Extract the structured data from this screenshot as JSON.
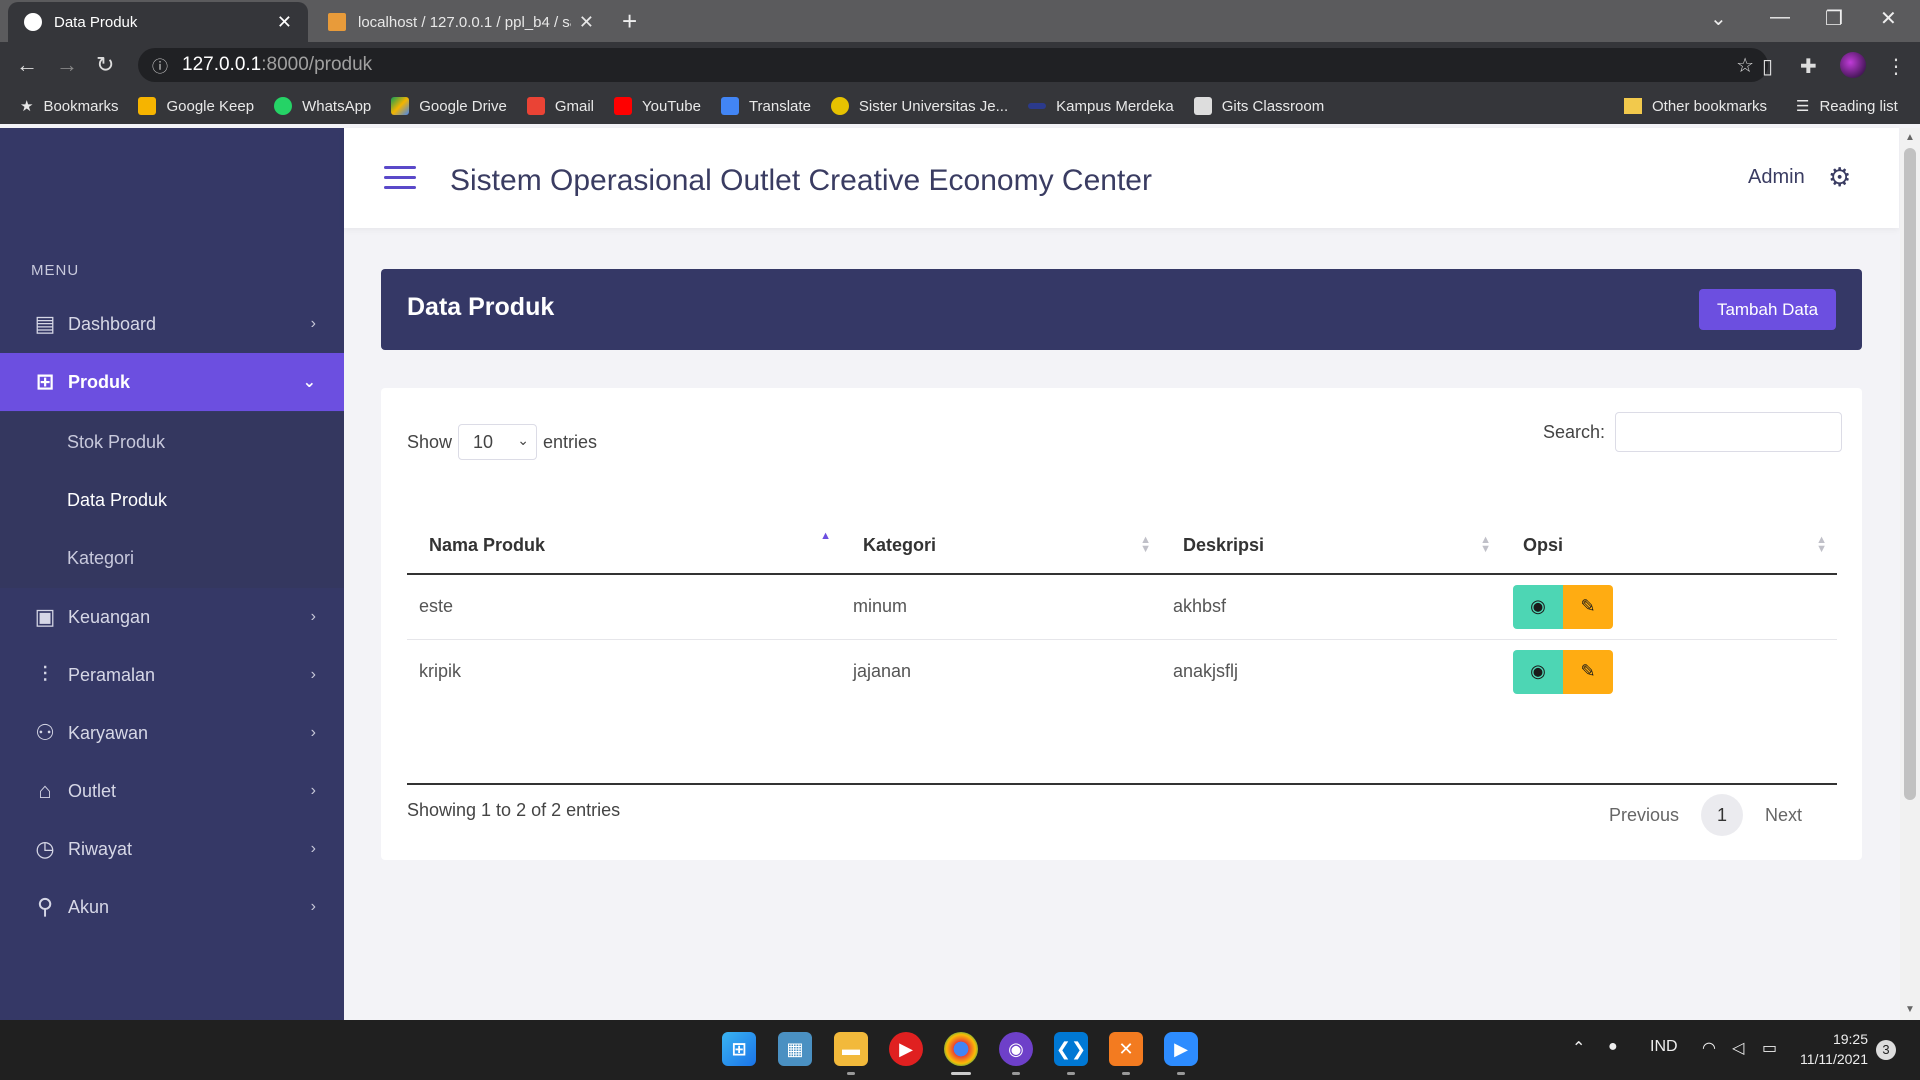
{
  "browser": {
    "tabs": [
      {
        "title": "Data Produk",
        "active": true
      },
      {
        "title": "localhost / 127.0.0.1 / ppl_b4 / sa",
        "active": false
      }
    ],
    "url_host": "127.0.0.1",
    "url_path": ":8000/produk",
    "bookmarks": [
      "Bookmarks",
      "Google Keep",
      "WhatsApp",
      "Google Drive",
      "Gmail",
      "YouTube",
      "Translate",
      "Sister Universitas Je...",
      "Kampus Merdeka",
      "Gits Classroom"
    ],
    "other_bookmarks": "Other bookmarks",
    "reading_list": "Reading list"
  },
  "header": {
    "title": "Sistem Operasional Outlet Creative Economy Center",
    "user": "Admin"
  },
  "sidebar": {
    "menu_label": "MENU",
    "items": [
      {
        "label": "Dashboard",
        "icon": "layout-icon"
      },
      {
        "label": "Produk",
        "icon": "grid-icon",
        "active": true
      },
      {
        "label": "Keuangan",
        "icon": "wallet-icon"
      },
      {
        "label": "Peramalan",
        "icon": "chart-icon"
      },
      {
        "label": "Karyawan",
        "icon": "users-icon"
      },
      {
        "label": "Outlet",
        "icon": "home-icon"
      },
      {
        "label": "Riwayat",
        "icon": "clock-icon"
      },
      {
        "label": "Akun",
        "icon": "user-icon"
      }
    ],
    "submenu": [
      {
        "label": "Stok Produk"
      },
      {
        "label": "Data Produk",
        "current": true
      },
      {
        "label": "Kategori"
      }
    ]
  },
  "page": {
    "title": "Data Produk",
    "add_button": "Tambah Data",
    "show_label": "Show",
    "entries_label": "entries",
    "page_length": "10",
    "search_label": "Search:",
    "columns": [
      "Nama Produk",
      "Kategori",
      "Deskripsi",
      "Opsi"
    ],
    "rows": [
      {
        "nama": "este",
        "kategori": "minum",
        "deskripsi": "akhbsf"
      },
      {
        "nama": "kripik",
        "kategori": "jajanan",
        "deskripsi": "anakjsflj"
      }
    ],
    "info": "Showing 1 to 2 of 2 entries",
    "pagination": {
      "previous": "Previous",
      "current": "1",
      "next": "Next"
    }
  },
  "taskbar": {
    "language": "IND",
    "time": "19:25",
    "date": "11/11/2021",
    "notifications": "3"
  },
  "colors": {
    "sidebar": "#353866",
    "accent": "#6c4fe0",
    "view_button": "#4dd6b4",
    "edit_button": "#ffac12"
  }
}
